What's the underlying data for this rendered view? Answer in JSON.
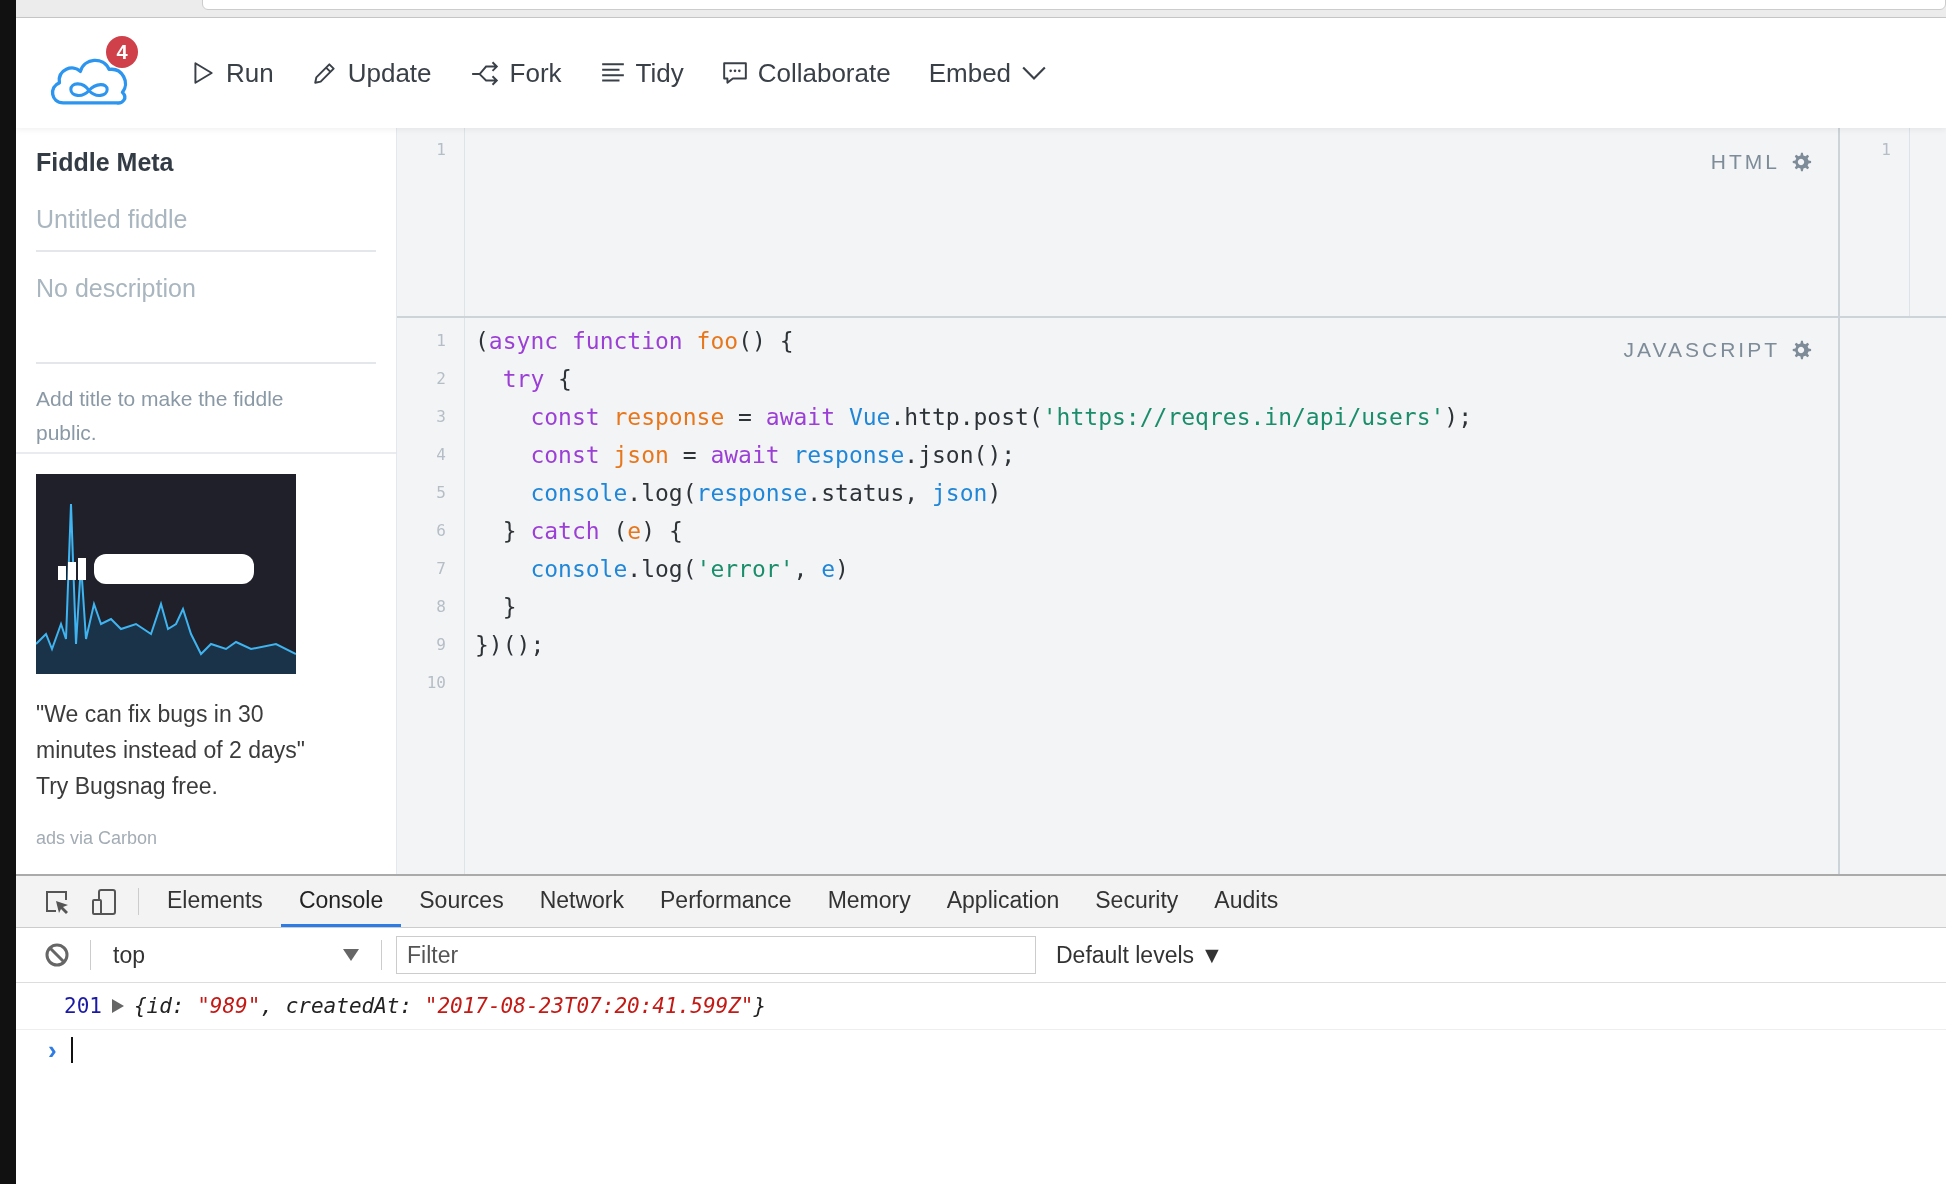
{
  "toolbar": {
    "badge": "4",
    "actions": [
      {
        "kind": "run",
        "label": "Run"
      },
      {
        "kind": "update",
        "label": "Update"
      },
      {
        "kind": "fork",
        "label": "Fork"
      },
      {
        "kind": "tidy",
        "label": "Tidy"
      },
      {
        "kind": "collaborate",
        "label": "Collaborate"
      },
      {
        "kind": "embed",
        "label": "Embed"
      }
    ]
  },
  "sidebar": {
    "heading": "Fiddle Meta",
    "title_field": {
      "placeholder": "Untitled fiddle"
    },
    "description_field": {
      "placeholder": "No description"
    },
    "note": "Add title to make the fiddle public.",
    "ad": {
      "quote": "\"We can fix bugs in 30 minutes instead of 2 days\"",
      "cta": "Try Bugsnag free.",
      "via": "ads via Carbon"
    }
  },
  "html_panel": {
    "label": "HTML",
    "line_numbers": [
      "1"
    ]
  },
  "js_panel": {
    "label": "JAVASCRIPT",
    "lines": [
      {
        "number": "1",
        "tokens": [
          {
            "t": "(",
            "kind": "plain"
          },
          {
            "t": "async function",
            "kind": "keyword"
          },
          {
            "t": " foo",
            "kind": "definition"
          },
          {
            "t": "() {",
            "kind": "plain"
          }
        ]
      },
      {
        "number": "2",
        "tokens": [
          {
            "t": "  try",
            "kind": "keyword"
          },
          {
            "t": " {",
            "kind": "plain"
          }
        ]
      },
      {
        "number": "3",
        "tokens": [
          {
            "t": "    const",
            "kind": "keyword"
          },
          {
            "t": " response",
            "kind": "definition"
          },
          {
            "t": " = ",
            "kind": "plain"
          },
          {
            "t": "await",
            "kind": "keyword"
          },
          {
            "t": " Vue",
            "kind": "variable"
          },
          {
            "t": ".http.post(",
            "kind": "plain"
          },
          {
            "t": "'https://reqres.in/api/users'",
            "kind": "string"
          },
          {
            "t": ");",
            "kind": "plain"
          }
        ]
      },
      {
        "number": "4",
        "tokens": [
          {
            "t": "    const",
            "kind": "keyword"
          },
          {
            "t": " json",
            "kind": "definition"
          },
          {
            "t": " = ",
            "kind": "plain"
          },
          {
            "t": "await",
            "kind": "keyword"
          },
          {
            "t": " response",
            "kind": "variable"
          },
          {
            "t": ".json();",
            "kind": "plain"
          }
        ]
      },
      {
        "number": "5",
        "tokens": [
          {
            "t": "    console",
            "kind": "variable"
          },
          {
            "t": ".log(",
            "kind": "plain"
          },
          {
            "t": "response",
            "kind": "variable"
          },
          {
            "t": ".status, ",
            "kind": "plain"
          },
          {
            "t": "json",
            "kind": "variable"
          },
          {
            "t": ")",
            "kind": "plain"
          }
        ]
      },
      {
        "number": "6",
        "tokens": [
          {
            "t": "  } ",
            "kind": "plain"
          },
          {
            "t": "catch",
            "kind": "keyword"
          },
          {
            "t": " (",
            "kind": "plain"
          },
          {
            "t": "e",
            "kind": "definition"
          },
          {
            "t": ") {",
            "kind": "plain"
          }
        ]
      },
      {
        "number": "7",
        "tokens": [
          {
            "t": "    console",
            "kind": "variable"
          },
          {
            "t": ".log(",
            "kind": "plain"
          },
          {
            "t": "'error'",
            "kind": "string"
          },
          {
            "t": ", ",
            "kind": "plain"
          },
          {
            "t": "e",
            "kind": "variable"
          },
          {
            "t": ")",
            "kind": "plain"
          }
        ]
      },
      {
        "number": "8",
        "tokens": [
          {
            "t": "  }",
            "kind": "plain"
          }
        ]
      },
      {
        "number": "9",
        "tokens": [
          {
            "t": "})();",
            "kind": "plain"
          }
        ]
      },
      {
        "number": "10"
      }
    ]
  },
  "result_panel": {
    "line_numbers": [
      "1"
    ]
  },
  "devtools": {
    "tabs": [
      {
        "label": "Elements",
        "selected": false
      },
      {
        "label": "Console",
        "selected": true
      },
      {
        "label": "Sources",
        "selected": false
      },
      {
        "label": "Network",
        "selected": false
      },
      {
        "label": "Performance",
        "selected": false
      },
      {
        "label": "Memory",
        "selected": false
      },
      {
        "label": "Application",
        "selected": false
      },
      {
        "label": "Security",
        "selected": false
      },
      {
        "label": "Audits",
        "selected": false
      }
    ],
    "context": "top",
    "filter": {
      "placeholder": "Filter"
    },
    "levels": "Default levels ▼",
    "log": {
      "status": "201",
      "object": [
        {
          "t": "{id: ",
          "kind": "plain"
        },
        {
          "t": "\"989\"",
          "kind": "string"
        },
        {
          "t": ", createdAt: ",
          "kind": "plain"
        },
        {
          "t": "\"2017-08-23T07:20:41.599Z\"",
          "kind": "string"
        },
        {
          "t": "}",
          "kind": "plain"
        }
      ]
    },
    "prompt": "›"
  }
}
